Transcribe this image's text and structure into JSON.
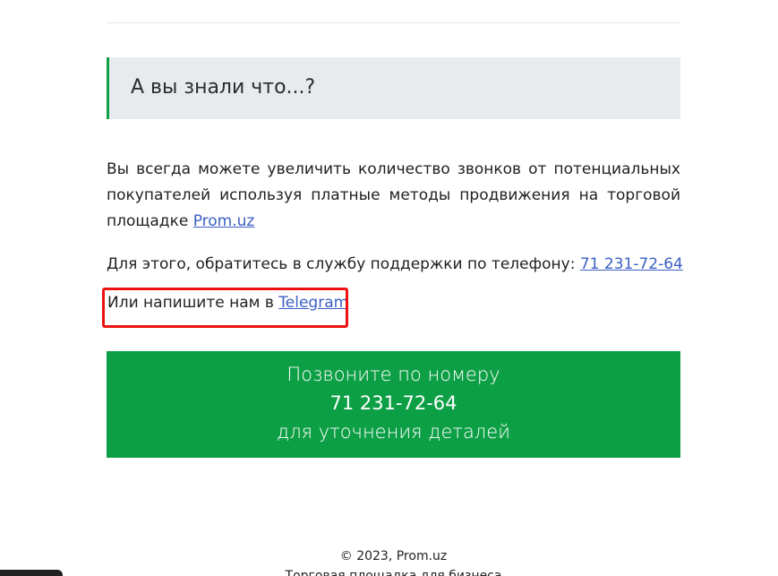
{
  "notice": {
    "title": "А вы знали что...?"
  },
  "info": {
    "line1": "Вы всегда можете увеличить количество звонков от потенциальных",
    "line2": "покупателей используя платные методы продвижения на торговой",
    "line3_prefix": "площадке ",
    "marketplace_link": "Prom.uz"
  },
  "support": {
    "text": "Для этого, обратитесь в службу поддержки по телефону: ",
    "phone_link": "71 231-72-64"
  },
  "telegram": {
    "text": "Или напишите нам в ",
    "link": "Telegram"
  },
  "cta": {
    "line1": "Позвоните по номеру",
    "phone": "71 231-72-64",
    "line3": "для уточнения деталей"
  },
  "footer": {
    "copyright": "© 2023, Prom.uz",
    "tagline": "Торговая площадка для бизнеса"
  },
  "colors": {
    "accent_green": "#0d9f45",
    "notice_bg": "#e8ebee",
    "link_blue": "#3b5fc4",
    "highlight_red": "#ee1111"
  }
}
